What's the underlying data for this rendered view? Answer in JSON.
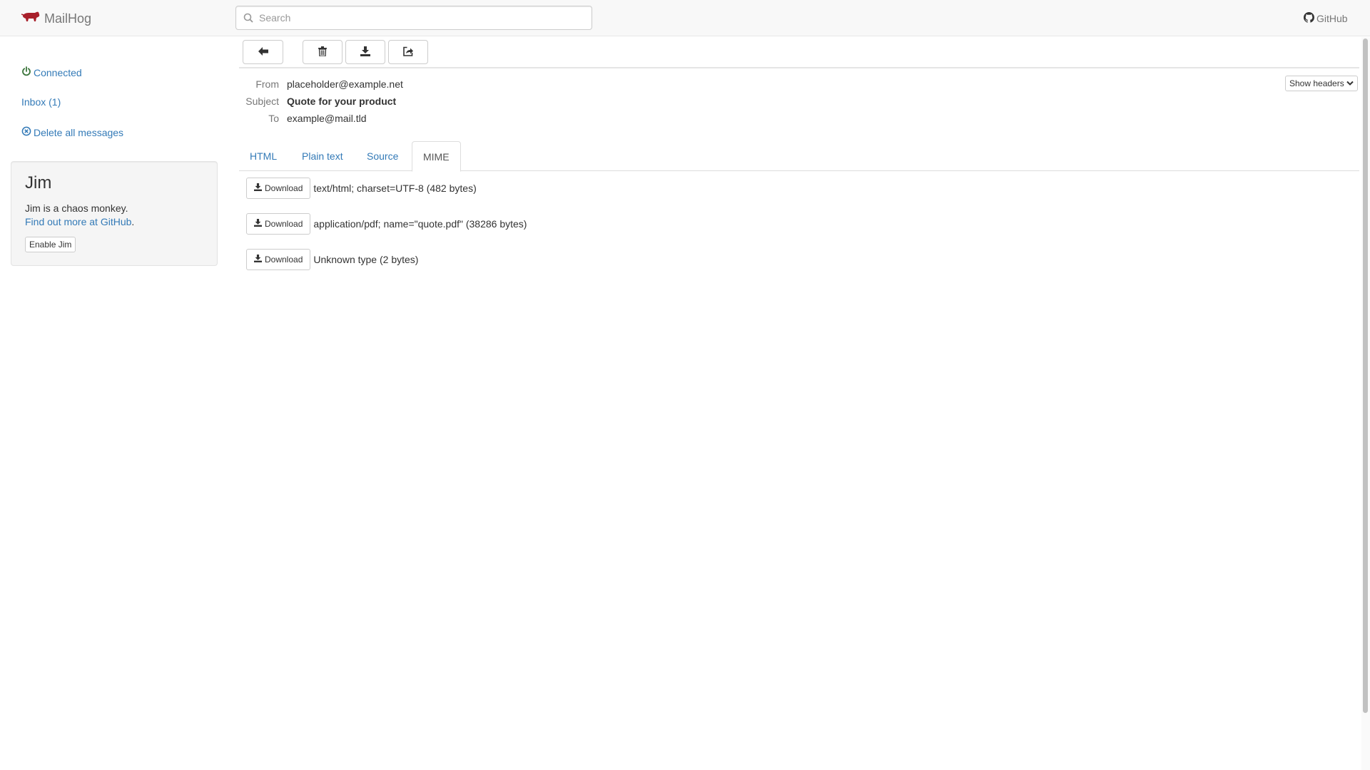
{
  "navbar": {
    "brand": "MailHog",
    "search_placeholder": "Search",
    "search_value": "",
    "github_label": "GitHub"
  },
  "sidebar": {
    "connected": "Connected",
    "inbox": "Inbox (1)",
    "delete_all": "Delete all messages"
  },
  "jim": {
    "title": "Jim",
    "description": "Jim is a chaos monkey.",
    "link_text": "Find out more at GitHub",
    "link_suffix": ".",
    "enable_button": "Enable Jim"
  },
  "message": {
    "from_label": "From",
    "from": "placeholder@example.net",
    "subject_label": "Subject",
    "subject": "Quote for your product",
    "to_label": "To",
    "to": "example@mail.tld",
    "show_headers": "Show headers"
  },
  "tabs": [
    {
      "label": "HTML"
    },
    {
      "label": "Plain text"
    },
    {
      "label": "Source"
    },
    {
      "label": "MIME",
      "active": true
    }
  ],
  "mime_parts": [
    {
      "button": "Download",
      "description": "text/html; charset=UTF-8 (482 bytes)"
    },
    {
      "button": "Download",
      "description": "application/pdf; name=\"quote.pdf\" (38286 bytes)"
    },
    {
      "button": "Download",
      "description": "Unknown type (2 bytes)"
    }
  ],
  "icons": {
    "brand": "pig-logo-icon",
    "search": "search-icon",
    "github": "github-icon",
    "connected": "power-icon",
    "delete_all": "remove-circle-icon",
    "back": "arrow-left-icon",
    "delete": "trash-icon",
    "download": "download-icon",
    "release": "share-icon",
    "show_headers": "chevron-down-icon"
  },
  "colors": {
    "link": "#337ab7",
    "connected": "#3c763d",
    "brand_logo": "#a8202b"
  }
}
